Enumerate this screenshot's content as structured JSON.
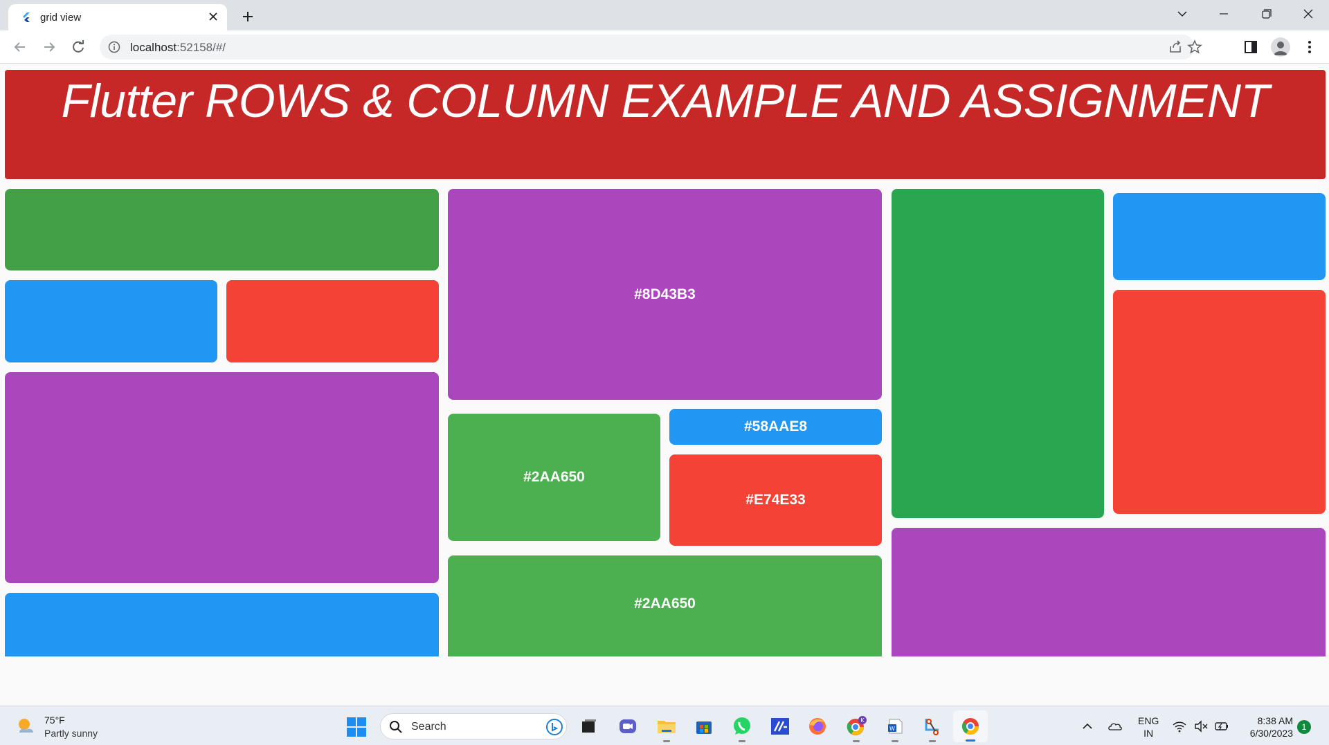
{
  "browser": {
    "tab_title": "grid view",
    "url_host": "localhost",
    "url_rest": ":52158/#/"
  },
  "app": {
    "title": "Flutter ROWS & COLUMN EXAMPLE AND ASSIGNMENT",
    "colors": {
      "red_header": "#C62828",
      "green": "#43A047",
      "blue": "#2196F3",
      "red": "#F44336",
      "purple": "#AB47BC",
      "dark_green": "#2AA650",
      "light_green": "#4CAF50"
    },
    "labels": {
      "purple_top": "#8D43B3",
      "green_small": "#2AA650",
      "blue_small": "#58AAE8",
      "red_small": "#E74E33",
      "green_bottom": "#2AA650"
    }
  },
  "taskbar": {
    "weather_temp": "75°F",
    "weather_desc": "Partly sunny",
    "search_placeholder": "Search",
    "lang_top": "ENG",
    "lang_bottom": "IN",
    "time": "8:38 AM",
    "date": "6/30/2023",
    "notification_count": "1"
  }
}
